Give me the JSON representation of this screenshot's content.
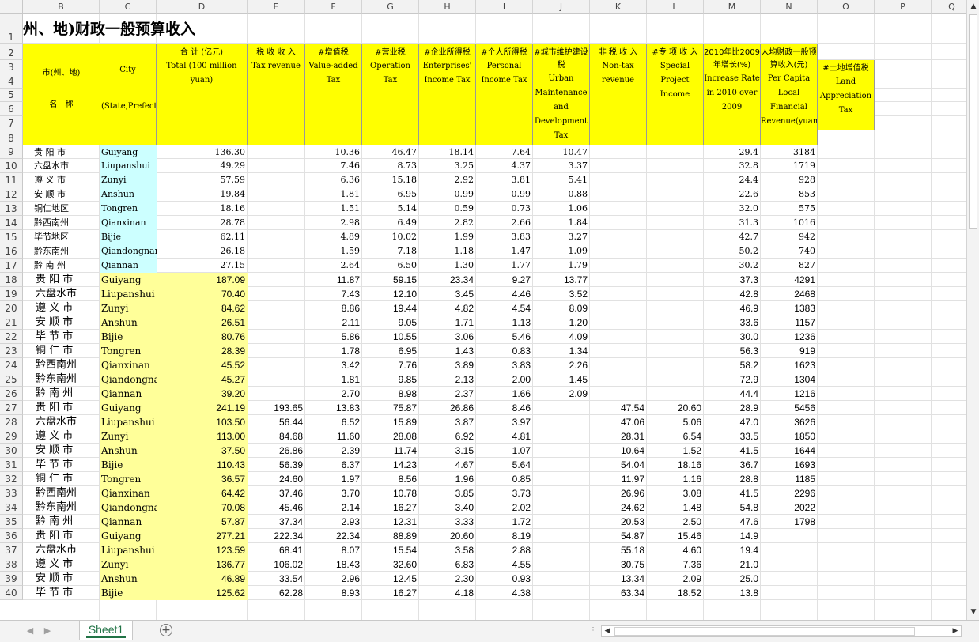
{
  "columns": [
    "B",
    "C",
    "D",
    "E",
    "F",
    "G",
    "H",
    "I",
    "J",
    "K",
    "L",
    "M",
    "N",
    "O",
    "P",
    "Q"
  ],
  "row_numbers": [
    "1",
    "2",
    "3",
    "4",
    "5",
    "6",
    "7",
    "8",
    "9",
    "10",
    "11",
    "12",
    "13",
    "14",
    "15",
    "16",
    "17",
    "18",
    "19",
    "20",
    "21",
    "22",
    "23",
    "24",
    "25",
    "26",
    "27",
    "28",
    "29",
    "30",
    "31",
    "32",
    "33",
    "34",
    "35",
    "36",
    "37",
    "38",
    "39",
    "40"
  ],
  "title": "州、地)财政一般预算收入",
  "header": {
    "region_zh": "市(州、地)",
    "region_zh2": "名　称",
    "city": "City",
    "city_en": "(State,Prefecture)",
    "total_zh": "合 计 (亿元)",
    "total_en": "Total (100 million yuan)",
    "tax_zh": "税 收 收 入",
    "tax_en": "Tax revenue",
    "vat_zh": "#增值税",
    "vat_en": "Value-added Tax",
    "op_zh": "#营业税",
    "op_en": "Operation Tax",
    "ent_zh": "#企业所得税",
    "ent_en": "Enterprises' Income Tax",
    "pers_zh": "#个人所得税",
    "pers_en": "Personal Income Tax",
    "urban_zh": "#城市维护建设税",
    "urban_en": "Urban Maintenance and Development Tax",
    "nontax_zh": "非 税 收 入",
    "nontax_en": "Non-tax revenue",
    "special_zh": "#专 项 收 入",
    "special_en": "Special Project Income",
    "growth_zh": "2010年比2009年增长(%)",
    "growth_en": "Increase Rate in 2010 over 2009",
    "percap_zh": "人均财政一般预算收入(元)",
    "percap_en": "Per Capita Local Financial Revenue(yuan)",
    "land_zh": "#土地增值税",
    "land_en": "Land Appreciation Tax"
  },
  "block1": [
    [
      "贵 阳 市",
      "Guiyang",
      "136.30",
      "",
      "10.36",
      "46.47",
      "18.14",
      "7.64",
      "10.47",
      "",
      "",
      "29.4",
      "3184"
    ],
    [
      "六盘水市",
      "Liupanshui",
      "49.29",
      "",
      "7.46",
      "8.73",
      "3.25",
      "4.37",
      "3.37",
      "",
      "",
      "32.8",
      "1719"
    ],
    [
      "遵 义 市",
      "Zunyi",
      "57.59",
      "",
      "6.36",
      "15.18",
      "2.92",
      "3.81",
      "5.41",
      "",
      "",
      "24.4",
      "928"
    ],
    [
      "安 顺 市",
      "Anshun",
      "19.84",
      "",
      "1.81",
      "6.95",
      "0.99",
      "0.99",
      "0.88",
      "",
      "",
      "22.6",
      "853"
    ],
    [
      "铜仁地区",
      "Tongren",
      "18.16",
      "",
      "1.51",
      "5.14",
      "0.59",
      "0.73",
      "1.06",
      "",
      "",
      "32.0",
      "575"
    ],
    [
      "黔西南州",
      "Qianxinan",
      "28.78",
      "",
      "2.98",
      "6.49",
      "2.82",
      "2.66",
      "1.84",
      "",
      "",
      "31.3",
      "1016"
    ],
    [
      "毕节地区",
      "Bijie",
      "62.11",
      "",
      "4.89",
      "10.02",
      "1.99",
      "3.83",
      "3.27",
      "",
      "",
      "42.7",
      "942"
    ],
    [
      "黔东南州",
      "Qiandongnan",
      "26.18",
      "",
      "1.59",
      "7.18",
      "1.18",
      "1.47",
      "1.09",
      "",
      "",
      "50.2",
      "740"
    ],
    [
      "黔 南 州",
      "Qiannan",
      "27.15",
      "",
      "2.64",
      "6.50",
      "1.30",
      "1.77",
      "1.79",
      "",
      "",
      "30.2",
      "827"
    ]
  ],
  "block2": [
    [
      "贵 阳 市",
      "Guiyang",
      "187.09",
      "",
      "11.87",
      "59.15",
      "23.34",
      "9.27",
      "13.77",
      "",
      "",
      "37.3",
      "4291"
    ],
    [
      "六盘水市",
      "Liupanshui",
      "70.40",
      "",
      "7.43",
      "12.10",
      "3.45",
      "4.46",
      "3.52",
      "",
      "",
      "42.8",
      "2468"
    ],
    [
      "遵 义 市",
      "Zunyi",
      "84.62",
      "",
      "8.86",
      "19.44",
      "4.82",
      "4.54",
      "8.09",
      "",
      "",
      "46.9",
      "1383"
    ],
    [
      "安 顺 市",
      "Anshun",
      "26.51",
      "",
      "2.11",
      "9.05",
      "1.71",
      "1.13",
      "1.20",
      "",
      "",
      "33.6",
      "1157"
    ],
    [
      "毕 节 市",
      "Bijie",
      "80.76",
      "",
      "5.86",
      "10.55",
      "3.06",
      "5.46",
      "4.09",
      "",
      "",
      "30.0",
      "1236"
    ],
    [
      "铜 仁 市",
      "Tongren",
      "28.39",
      "",
      "1.78",
      "6.95",
      "1.43",
      "0.83",
      "1.34",
      "",
      "",
      "56.3",
      "919"
    ],
    [
      "黔西南州",
      "Qianxinan",
      "45.52",
      "",
      "3.42",
      "7.76",
      "3.89",
      "3.83",
      "2.26",
      "",
      "",
      "58.2",
      "1623"
    ],
    [
      "黔东南州",
      "Qiandongnan",
      "45.27",
      "",
      "1.81",
      "9.85",
      "2.13",
      "2.00",
      "1.45",
      "",
      "",
      "72.9",
      "1304"
    ],
    [
      "黔 南 州",
      "Qiannan",
      "39.20",
      "",
      "2.70",
      "8.98",
      "2.37",
      "1.66",
      "2.09",
      "",
      "",
      "44.4",
      "1216"
    ],
    [
      "贵 阳 市",
      "Guiyang",
      "241.19",
      "193.65",
      "13.83",
      "75.87",
      "26.86",
      "8.46",
      "",
      "47.54",
      "20.60",
      "28.9",
      "5456"
    ],
    [
      "六盘水市",
      "Liupanshui",
      "103.50",
      "56.44",
      "6.52",
      "15.89",
      "3.87",
      "3.97",
      "",
      "47.06",
      "5.06",
      "47.0",
      "3626"
    ],
    [
      "遵 义 市",
      "Zunyi",
      "113.00",
      "84.68",
      "11.60",
      "28.08",
      "6.92",
      "4.81",
      "",
      "28.31",
      "6.54",
      "33.5",
      "1850"
    ],
    [
      "安 顺 市",
      "Anshun",
      "37.50",
      "26.86",
      "2.39",
      "11.74",
      "3.15",
      "1.07",
      "",
      "10.64",
      "1.52",
      "41.5",
      "1644"
    ],
    [
      "毕 节 市",
      "Bijie",
      "110.43",
      "56.39",
      "6.37",
      "14.23",
      "4.67",
      "5.64",
      "",
      "54.04",
      "18.16",
      "36.7",
      "1693"
    ],
    [
      "铜 仁 市",
      "Tongren",
      "36.57",
      "24.60",
      "1.97",
      "8.56",
      "1.96",
      "0.85",
      "",
      "11.97",
      "1.16",
      "28.8",
      "1185"
    ],
    [
      "黔西南州",
      "Qianxinan",
      "64.42",
      "37.46",
      "3.70",
      "10.78",
      "3.85",
      "3.73",
      "",
      "26.96",
      "3.08",
      "41.5",
      "2296"
    ],
    [
      "黔东南州",
      "Qiandongnan",
      "70.08",
      "45.46",
      "2.14",
      "16.27",
      "3.40",
      "2.02",
      "",
      "24.62",
      "1.48",
      "54.8",
      "2022"
    ],
    [
      "黔 南 州",
      "Qiannan",
      "57.87",
      "37.34",
      "2.93",
      "12.31",
      "3.33",
      "1.72",
      "",
      "20.53",
      "2.50",
      "47.6",
      "1798"
    ],
    [
      "贵 阳 市",
      "Guiyang",
      "277.21",
      "222.34",
      "22.34",
      "88.89",
      "20.60",
      "8.19",
      "",
      "54.87",
      "15.46",
      "14.9",
      ""
    ],
    [
      "六盘水市",
      "Liupanshui",
      "123.59",
      "68.41",
      "8.07",
      "15.54",
      "3.58",
      "2.88",
      "",
      "55.18",
      "4.60",
      "19.4",
      ""
    ],
    [
      "遵 义 市",
      "Zunyi",
      "136.77",
      "106.02",
      "18.43",
      "32.60",
      "6.83",
      "4.55",
      "",
      "30.75",
      "7.36",
      "21.0",
      ""
    ],
    [
      "安 顺 市",
      "Anshun",
      "46.89",
      "33.54",
      "2.96",
      "12.45",
      "2.30",
      "0.93",
      "",
      "13.34",
      "2.09",
      "25.0",
      ""
    ],
    [
      "毕 节 市",
      "Bijie",
      "125.62",
      "62.28",
      "8.93",
      "16.27",
      "4.18",
      "4.38",
      "",
      "63.34",
      "18.52",
      "13.8",
      ""
    ]
  ],
  "sheet_tab": "Sheet1",
  "icons": {
    "add_sheet": "plus-circle-icon",
    "scroll_left": "triangle-left-icon",
    "scroll_right": "triangle-right-icon"
  },
  "colors": {
    "header_yellow": "#ffff00",
    "light_cyan": "#ccffff",
    "light_yellow": "#ffff99",
    "sheet_tab_green": "#217346"
  }
}
